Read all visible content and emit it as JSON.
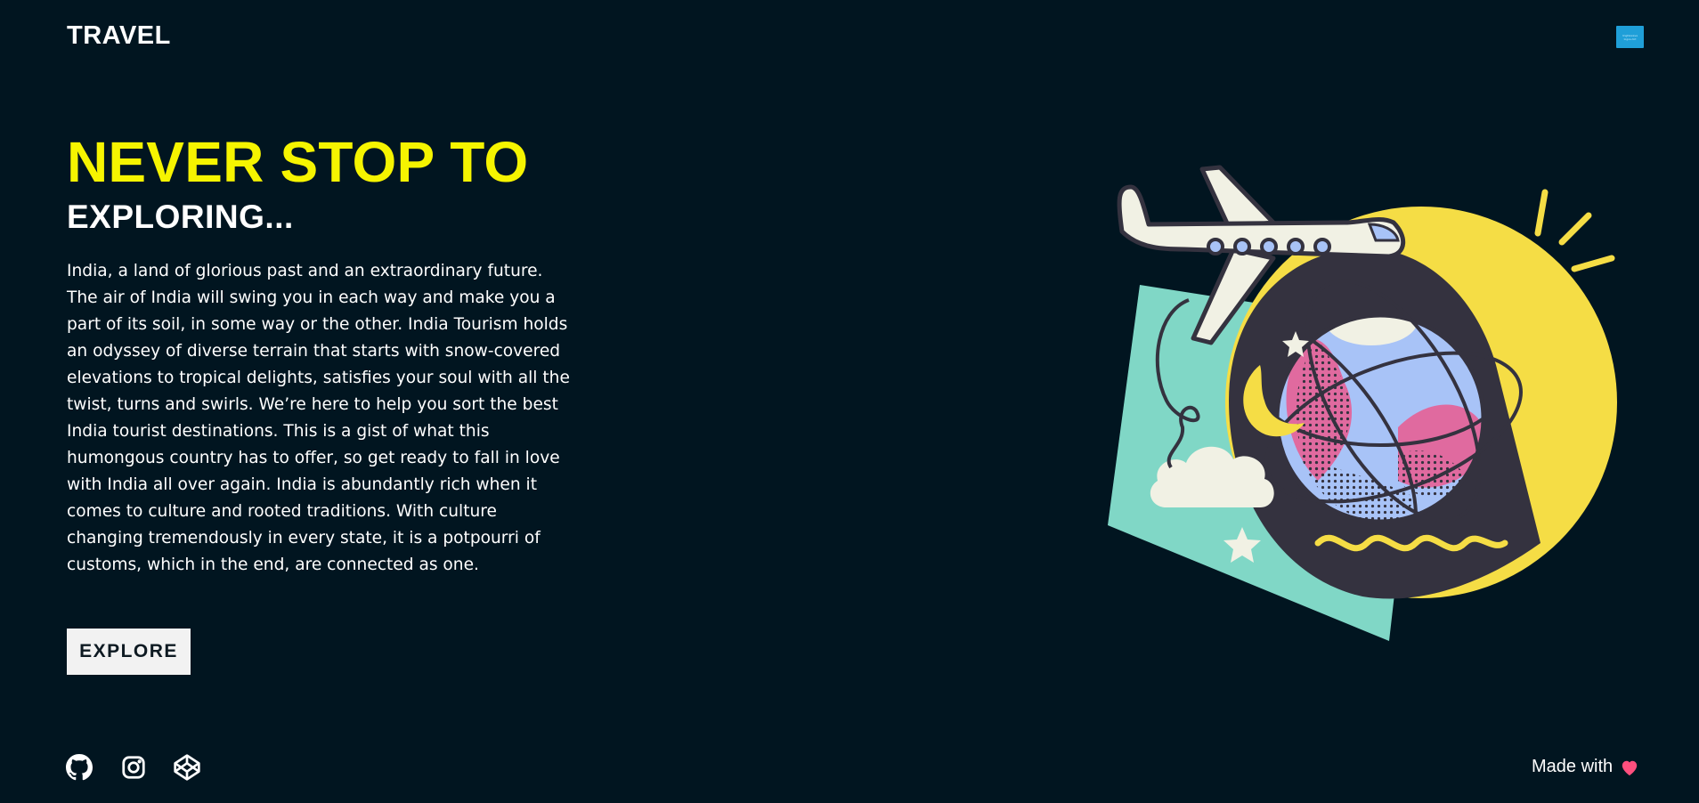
{
  "header": {
    "logo": "TRAVEL",
    "menu_button_text": [
      "lingfeiwave",
      "logos.dot"
    ]
  },
  "hero": {
    "headline_line1": "NEVER STOP TO",
    "headline_line2": "EXPLORING...",
    "description": "India, a land of glorious past and an extraordinary future. The air of India will swing you in each way and make you a part of its soil, in some way or the other. India Tourism holds an odyssey of diverse terrain that starts with snow-covered elevations to tropical delights, satisfies your soul with all the twist, turns and swirls. We’re here to help you sort the best India tourist destinations. This is a gist of what this humongous country has to offer, so get ready to fall in love with India all over again. India is abundantly rich when it comes to culture and rooted traditions. With culture changing tremendously in every state, it is a potpourri of customs, which in the end, are connected as one.",
    "explore_label": "EXPLORE"
  },
  "footer": {
    "social_icons": [
      "github-icon",
      "instagram-icon",
      "codepen-icon"
    ],
    "made_with": "Made with",
    "heart_icon": "heart-icon"
  },
  "colors": {
    "background": "#011520",
    "accent_yellow": "#f6f400",
    "button_bg": "#f2f2f2",
    "heart": "#ff4f7e"
  }
}
